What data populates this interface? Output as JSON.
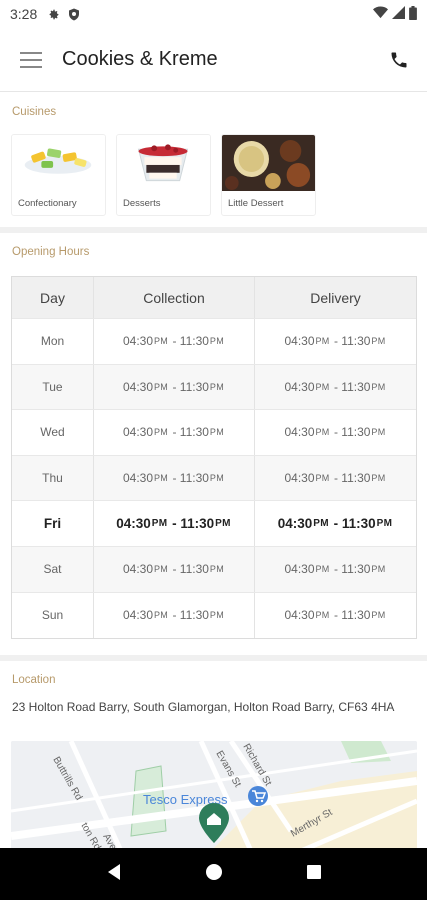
{
  "status": {
    "time": "3:28"
  },
  "appbar": {
    "title": "Cookies & Kreme"
  },
  "cuisines": {
    "label": "Cuisines",
    "items": [
      {
        "label": "Confectionary"
      },
      {
        "label": "Desserts"
      },
      {
        "label": "Little Dessert"
      }
    ]
  },
  "hours": {
    "label": "Opening Hours",
    "headers": {
      "day": "Day",
      "collection": "Collection",
      "delivery": "Delivery"
    },
    "rows": [
      {
        "day": "Mon",
        "c_from": "04:30",
        "c_to": "11:30",
        "d_from": "04:30",
        "d_to": "11:30"
      },
      {
        "day": "Tue",
        "c_from": "04:30",
        "c_to": "11:30",
        "d_from": "04:30",
        "d_to": "11:30"
      },
      {
        "day": "Wed",
        "c_from": "04:30",
        "c_to": "11:30",
        "d_from": "04:30",
        "d_to": "11:30"
      },
      {
        "day": "Thu",
        "c_from": "04:30",
        "c_to": "11:30",
        "d_from": "04:30",
        "d_to": "11:30"
      },
      {
        "day": "Fri",
        "c_from": "04:30",
        "c_to": "11:30",
        "d_from": "04:30",
        "d_to": "11:30"
      },
      {
        "day": "Sat",
        "c_from": "04:30",
        "c_to": "11:30",
        "d_from": "04:30",
        "d_to": "11:30"
      },
      {
        "day": "Sun",
        "c_from": "04:30",
        "c_to": "11:30",
        "d_from": "04:30",
        "d_to": "11:30"
      }
    ],
    "pm": "PM",
    "sep": " - "
  },
  "location": {
    "label": "Location",
    "address": "23 Holton Road Barry, South Glamorgan, Holton Road Barry, CF63 4HA",
    "map_labels": {
      "poi": "Tesco Express",
      "road1": "Buttrills Rd",
      "road2": "Richard St",
      "road3": "Evans St",
      "road4": "Merthyr St",
      "road5": "ton Rd",
      "road6": "Ave"
    }
  },
  "colors": {
    "accent": "#b79a6b",
    "poi": "#4a86d9",
    "pin": "#2e7d5b"
  }
}
